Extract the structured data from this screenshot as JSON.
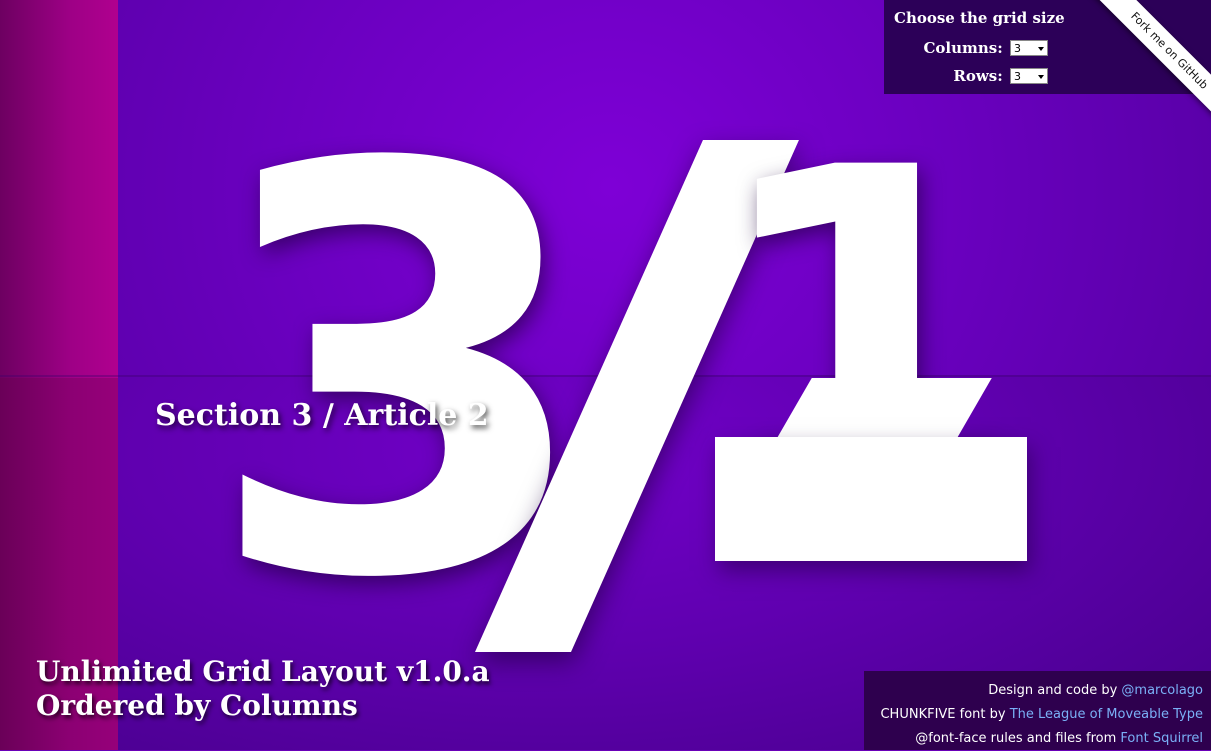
{
  "background": {
    "primary": "#6a00b8",
    "left_strip": "#9e0086"
  },
  "hero": {
    "number": "3",
    "separator": "/",
    "second_number": "1"
  },
  "section_title": "Section 3 / Article 2",
  "grid_controls": {
    "heading": "Choose the grid size",
    "columns_label": "Columns:",
    "columns_value": "3",
    "rows_label": "Rows:",
    "rows_value": "3"
  },
  "ribbon": {
    "label": "Fork me on GitHub"
  },
  "app_title": {
    "line1": "Unlimited Grid Layout v1.0.a",
    "line2": "Ordered by Columns"
  },
  "credits": {
    "line1_prefix": "Design and code by ",
    "line1_link": "@marcolago",
    "line2_prefix": "CHUNKFIVE font by ",
    "line2_link": "The League of Moveable Type",
    "line3_prefix": "@font-face rules and files from ",
    "line3_link": "Font Squirrel",
    "link_color": "#7ab0f6"
  }
}
